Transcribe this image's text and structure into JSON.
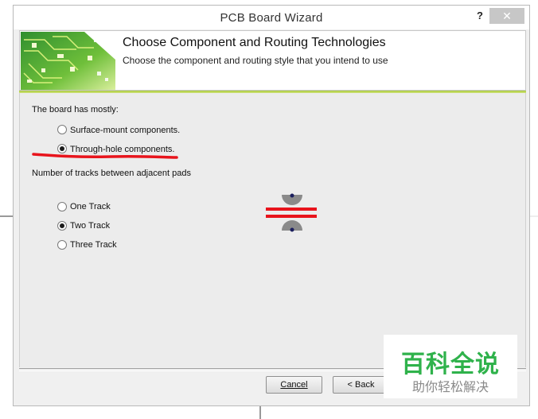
{
  "window": {
    "title": "PCB Board Wizard",
    "help_label": "?",
    "close_label": "✕"
  },
  "header": {
    "title": "Choose Component and Routing Technologies",
    "subtitle": "Choose the component and routing style that you intend to use"
  },
  "component_group": {
    "label": "The board has mostly:",
    "options": [
      {
        "label": "Surface-mount components.",
        "selected": false
      },
      {
        "label": "Through-hole components.",
        "selected": true
      }
    ]
  },
  "tracks_group": {
    "label": "Number of tracks between adjacent pads",
    "options": [
      {
        "label": "One Track",
        "selected": false
      },
      {
        "label": "Two Track",
        "selected": true
      },
      {
        "label": "Three Track",
        "selected": false
      }
    ]
  },
  "buttons": {
    "cancel": "Cancel",
    "back": "< Back"
  },
  "watermark": {
    "main": "百科全说",
    "sub": "助你轻松解决"
  },
  "colors": {
    "annotation_red": "#e8141c",
    "accent_green": "#a9c93a",
    "watermark_green": "#2fb24b"
  }
}
